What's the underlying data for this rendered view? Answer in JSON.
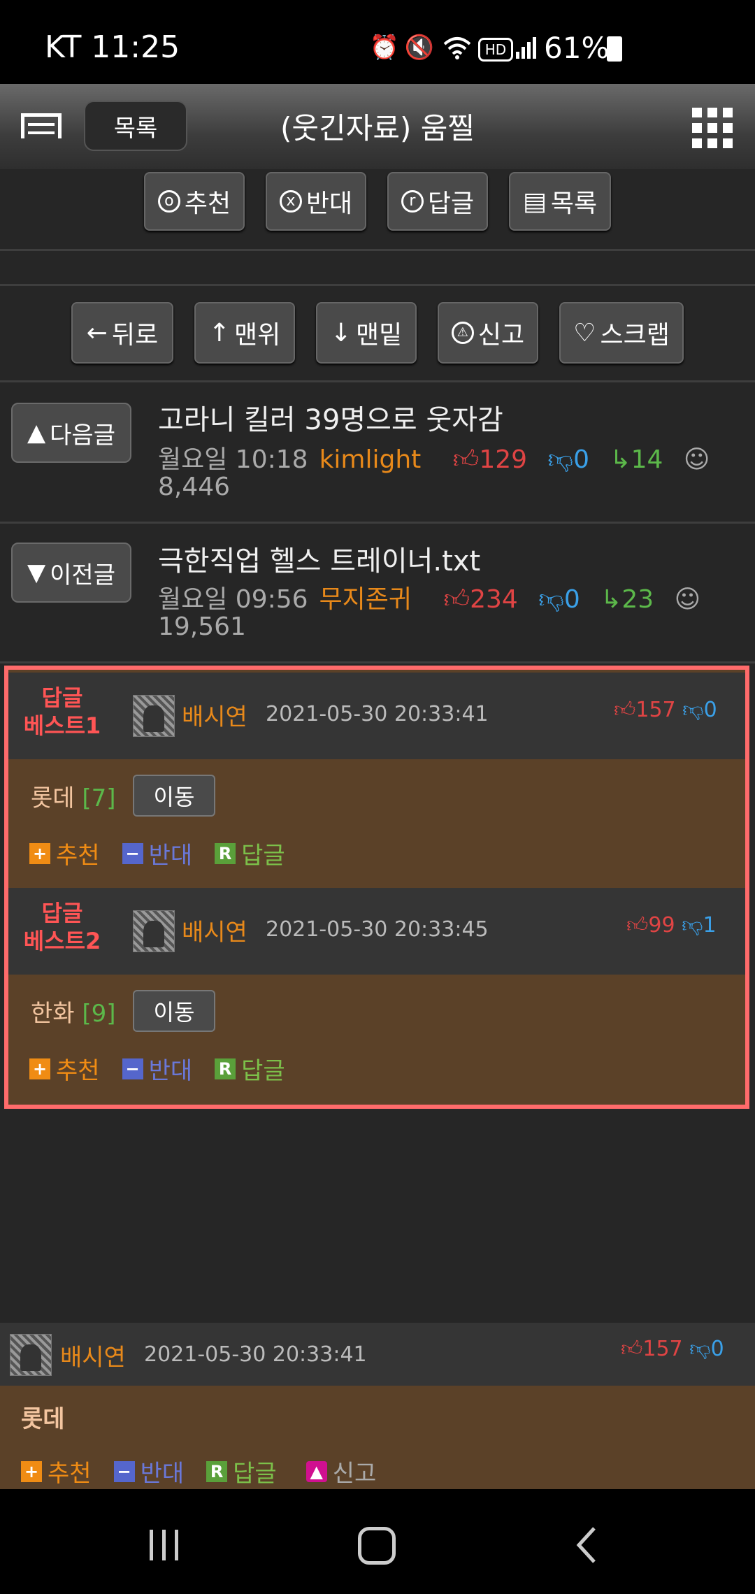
{
  "status": {
    "carrier_time": "KT 11:25",
    "battery": "61%"
  },
  "header": {
    "list_button": "목록",
    "title": "(웃긴자료)  움찔"
  },
  "top_actions": [
    {
      "icon": "o",
      "label": "추천"
    },
    {
      "icon": "x",
      "label": "반대"
    },
    {
      "icon": "r",
      "label": "답글"
    },
    {
      "icon": "list",
      "label": "목록"
    }
  ],
  "nav_actions": [
    {
      "icon": "←",
      "label": "뒤로"
    },
    {
      "icon": "↑",
      "label": "맨위"
    },
    {
      "icon": "↓",
      "label": "맨밑"
    },
    {
      "icon": "report",
      "label": "신고"
    },
    {
      "icon": "♡",
      "label": "스크랩"
    }
  ],
  "next_post": {
    "button": "다음글",
    "title": "고라니 킬러 39명으로 웃자감",
    "time": "월요일 10:18",
    "author": "kimlight",
    "up": "129",
    "down": "0",
    "replies": "14",
    "views": "8,446"
  },
  "prev_post": {
    "button": "이전글",
    "title": "극한직업 헬스 트레이너.txt",
    "time": "월요일 09:56",
    "author": "무지존귀",
    "up": "234",
    "down": "0",
    "replies": "23",
    "views": "19,561"
  },
  "best_replies": [
    {
      "label_line1": "답글",
      "label_line2": "베스트1",
      "author": "배시연",
      "date": "2021-05-30 20:33:41",
      "up": "157",
      "down": "0",
      "text": "롯데",
      "count": "[7]",
      "move": "이동"
    },
    {
      "label_line1": "답글",
      "label_line2": "베스트2",
      "author": "배시연",
      "date": "2021-05-30 20:33:45",
      "up": "99",
      "down": "1",
      "text": "한화",
      "count": "[9]",
      "move": "이동"
    }
  ],
  "reply_actions": {
    "recommend": "추천",
    "oppose": "반대",
    "reply": "답글",
    "report": "신고"
  },
  "comment": {
    "author": "배시연",
    "date": "2021-05-30 20:33:41",
    "up": "157",
    "down": "0",
    "text": "롯데"
  },
  "colors": {
    "accent_orange": "#e8891a",
    "upvote": "#e04444",
    "downvote": "#3aa0e8",
    "highlight_border": "#ff6b6b",
    "reply_bg": "#5b4128"
  }
}
